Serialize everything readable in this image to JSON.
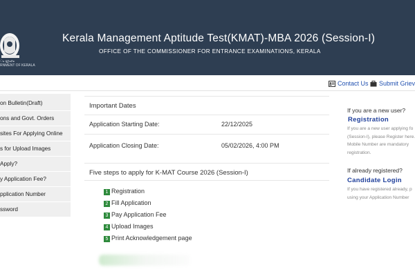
{
  "header": {
    "title": "Kerala Management Aptitude Test(KMAT)-MBA 2026 (Session-I)",
    "subtitle": "OFFICE OF THE COMMISSIONER FOR ENTRANCE EXAMINATIONS, KERALA",
    "emblem_text_1": "ം ഗ്രഹം",
    "emblem_text_2": "RNMENT OF KERALA"
  },
  "top_links": {
    "contact": "Contact Us",
    "grievance": "Submit Grieva"
  },
  "sidebar": {
    "items": [
      {
        "label": "on Bulletin(Draft)"
      },
      {
        "label": "ons and Govt. Orders"
      },
      {
        "label": "sites For Applying Online"
      },
      {
        "label": "s for Upload Images"
      },
      {
        "label": "Apply?"
      },
      {
        "label": "y Application Fee?"
      },
      {
        "label": "pplication Number"
      },
      {
        "label": "ssword"
      }
    ]
  },
  "important_dates": {
    "heading": "Important Dates",
    "rows": [
      {
        "label": "Application Starting Date:",
        "value": "22/12/2025"
      },
      {
        "label": "Application Closing Date:",
        "value": "05/02/2026, 4:00 PM"
      }
    ]
  },
  "steps": {
    "heading": "Five steps to apply for K-MAT Course 2026 (Session-I)",
    "items": [
      {
        "num": "1",
        "label": "Registration"
      },
      {
        "num": "2",
        "label": "Fill Application"
      },
      {
        "num": "3",
        "label": "Pay Application Fee"
      },
      {
        "num": "4",
        "label": "Upload Images"
      },
      {
        "num": "5",
        "label": "Print Acknowledgement page"
      }
    ]
  },
  "right_panel": {
    "new_user_q": "If you are a new user?",
    "registration_link": "Registration",
    "new_user_note": [
      "If you are a new user applying fo",
      "(Session-I), please Register here.",
      "Mobile Number are mandatory",
      "registration."
    ],
    "registered_q": "If already registered?",
    "login_link": "Candidate Login",
    "registered_note": [
      "If you have registered already, p",
      "using your Application Number"
    ]
  },
  "colors": {
    "header_bg": "#2e3e52",
    "link": "#2050b0",
    "step_badge": "#2e8a3c",
    "sidebar_bg": "#efefef"
  }
}
